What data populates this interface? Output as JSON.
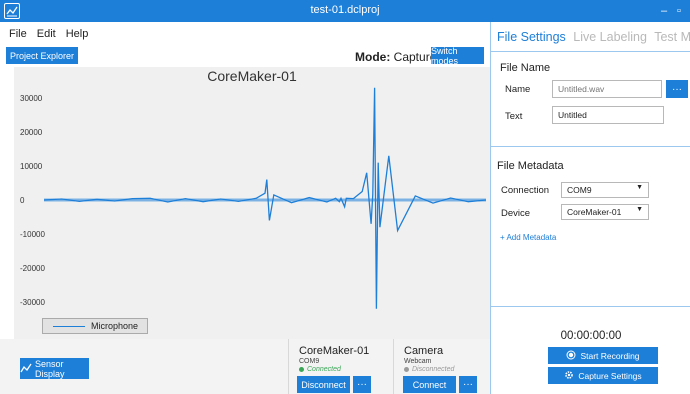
{
  "window": {
    "title": "test-01.dclproj",
    "minimize_glyph": "–",
    "maximize_glyph": "▫"
  },
  "menu": [
    "File",
    "Edit",
    "Help"
  ],
  "toolbar": {
    "project_explorer_label": "Project Explorer",
    "mode_label": "Mode:",
    "mode_value": "Capture",
    "switch_modes_label": "Switch modes"
  },
  "chart_data": {
    "type": "line",
    "title": "CoreMaker-01",
    "xlabel": "",
    "ylabel": "",
    "ylim": [
      -35000,
      35000
    ],
    "yticks": [
      30000,
      20000,
      10000,
      0,
      -10000,
      -20000,
      -30000
    ],
    "ytick_labels": [
      "30000",
      "20000",
      "10000",
      "0",
      "-10000",
      "-20000",
      "-30000"
    ],
    "grid": false,
    "legend_position": "bottom-left",
    "series": [
      {
        "name": "Microphone",
        "color": "#1e7fd8",
        "x": [
          0,
          20,
          40,
          60,
          80,
          100,
          120,
          140,
          160,
          180,
          200,
          220,
          240,
          250,
          252,
          255,
          260,
          280,
          300,
          320,
          330,
          334,
          336,
          340,
          342,
          350,
          360,
          365,
          370,
          372,
          374,
          376,
          378,
          380,
          390,
          400,
          420,
          440,
          460,
          480,
          500
        ],
        "y": [
          0,
          300,
          -400,
          200,
          -300,
          400,
          500,
          -600,
          400,
          -500,
          300,
          -400,
          500,
          2000,
          6000,
          -6000,
          1500,
          -800,
          700,
          -600,
          500,
          -500,
          500,
          -2000,
          500,
          400,
          2500,
          8000,
          -7000,
          1800,
          33000,
          -32000,
          11000,
          -8000,
          13000,
          -9000,
          1200,
          -900,
          600,
          -500,
          0
        ]
      }
    ]
  },
  "sensor_display_label": "Sensor Display",
  "devices": [
    {
      "name": "CoreMaker-01",
      "port": "COM9",
      "status": "Connected",
      "status_color": "#3aa757",
      "action_label": "Disconnect",
      "more_label": "···"
    },
    {
      "name": "Camera",
      "port": "Webcam",
      "status": "Disconnected",
      "status_color": "#9a9a9a",
      "action_label": "Connect",
      "more_label": "···"
    }
  ],
  "right_panel": {
    "tabs": [
      {
        "label": "File Settings",
        "active": true
      },
      {
        "label": "Live Labeling",
        "active": false
      },
      {
        "label": "Test Model",
        "active": false
      }
    ],
    "file_name": {
      "section_title": "File Name",
      "name_label": "Name",
      "name_placeholder": "Untitled.wav",
      "browse_label": "···",
      "text_label": "Text",
      "text_value": "Untitled"
    },
    "file_metadata": {
      "section_title": "File Metadata",
      "connection_label": "Connection",
      "connection_value": "COM9",
      "device_label": "Device",
      "device_value": "CoreMaker-01",
      "add_metadata_label": "+ Add Metadata"
    },
    "timer": "00:00:00:00",
    "start_recording_label": "Start Recording",
    "capture_settings_label": "Capture Settings"
  },
  "colors": {
    "accent": "#1e7fd8",
    "connected": "#3aa757",
    "disconnected": "#9a9a9a"
  }
}
